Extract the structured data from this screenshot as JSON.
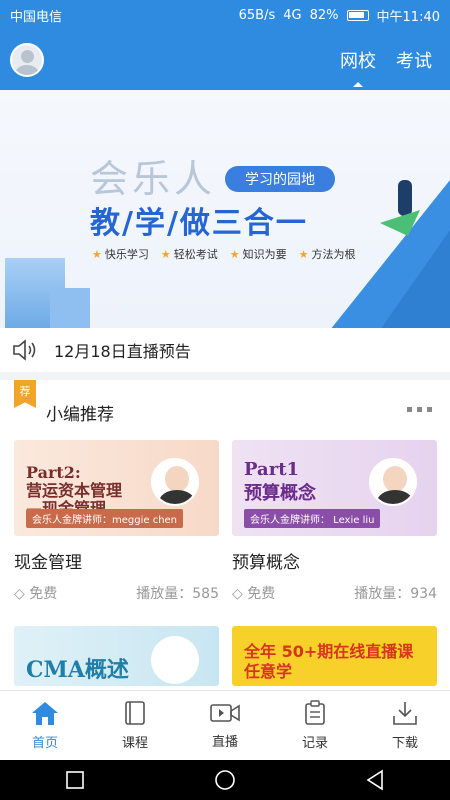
{
  "status": {
    "carrier": "中国电信",
    "speed": "65B/s",
    "signal": "4G",
    "battery": "82%",
    "time": "中午11:40"
  },
  "header": {
    "tabs": [
      {
        "label": "网校",
        "active": true
      },
      {
        "label": "考试",
        "active": false
      }
    ]
  },
  "banner": {
    "line1": "会乐人",
    "pill": "学习的园地",
    "line2": "教/学/做三合一",
    "tags": [
      "快乐学习",
      "轻松考试",
      "知识为要",
      "方法为根"
    ]
  },
  "notice": {
    "text": "12月18日直播预告"
  },
  "recommend": {
    "badge": "荐",
    "title": "小编推荐",
    "courses": [
      {
        "thumb_title": "Part2:\n营运资本管理\n—现金管理",
        "lecturer": "会乐人金牌讲师：meggie chen",
        "name": "现金管理",
        "price": "免费",
        "plays": "播放量：585"
      },
      {
        "thumb_title": "Part1\n预算概念",
        "lecturer": "会乐人金牌讲师： Lexie liu",
        "name": "预算概念",
        "price": "免费",
        "plays": "播放量：934"
      }
    ],
    "more_cards": [
      {
        "thumb_title": "CMA概述"
      },
      {
        "thumb_title": "全年 50+期在线直播课 任意学"
      }
    ]
  },
  "bottom_nav": [
    {
      "label": "首页",
      "icon": "home-icon",
      "active": true
    },
    {
      "label": "课程",
      "icon": "book-icon",
      "active": false
    },
    {
      "label": "直播",
      "icon": "video-icon",
      "active": false
    },
    {
      "label": "记录",
      "icon": "clipboard-icon",
      "active": false
    },
    {
      "label": "下载",
      "icon": "download-icon",
      "active": false
    }
  ],
  "colors": {
    "primary": "#2f8be0",
    "accent": "#f0a52a"
  }
}
